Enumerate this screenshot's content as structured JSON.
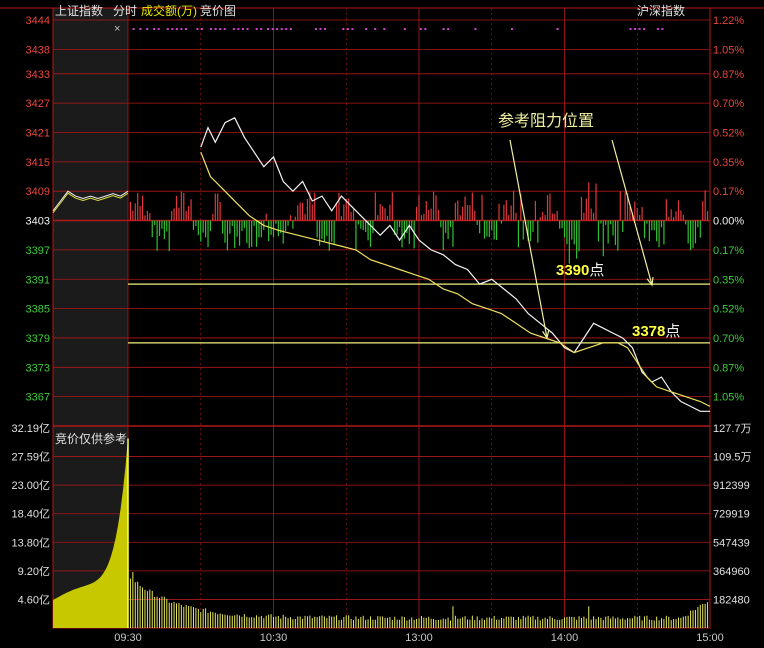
{
  "header": {
    "index_name": "上证指数",
    "tab_timeshare": "分时",
    "tab_turnover": "成交额(万)",
    "tab_auction": "竞价图",
    "right_label": "沪深指数",
    "close_symbol": "×"
  },
  "annotations": {
    "resistance_title": "参考阻力位置",
    "level1_value": "3390",
    "level2_value": "3378",
    "unit": "点"
  },
  "volume_panel_label": "竞价仅供参考",
  "chart_data": [
    {
      "type": "line",
      "title": "上证指数 分时",
      "prev_close": 3403,
      "y_ticks": [
        3444,
        3438,
        3433,
        3427,
        3421,
        3415,
        3409,
        3403,
        3397,
        3391,
        3385,
        3379,
        3373,
        3367
      ],
      "pct_ticks": [
        "1.22%",
        "1.05%",
        "0.87%",
        "0.70%",
        "0.52%",
        "0.35%",
        "0.17%",
        "0.00%",
        "0.17%",
        "0.35%",
        "0.52%",
        "0.70%",
        "0.87%",
        "1.05%"
      ],
      "ylim": [
        3361,
        3444
      ],
      "x_ticks": [
        "09:30",
        "10:30",
        "13:00",
        "14:00",
        "15:00"
      ],
      "horizontal_levels": [
        3390,
        3378
      ],
      "auction_series": [
        [
          0,
          3405
        ],
        [
          3,
          3407
        ],
        [
          6,
          3409
        ],
        [
          9,
          3408
        ],
        [
          12,
          3407.5
        ],
        [
          15,
          3408
        ],
        [
          18,
          3407.5
        ],
        [
          21,
          3408
        ],
        [
          24,
          3408.5
        ],
        [
          27,
          3408
        ],
        [
          30,
          3409
        ]
      ],
      "series": [
        {
          "points": [
            [
              30,
              3418
            ],
            [
              33,
              3422
            ],
            [
              36,
              3419
            ],
            [
              40,
              3423
            ],
            [
              44,
              3424
            ],
            [
              48,
              3420
            ],
            [
              52,
              3417
            ],
            [
              56,
              3414
            ],
            [
              60,
              3416
            ],
            [
              64,
              3411
            ],
            [
              68,
              3409
            ],
            [
              72,
              3411
            ],
            [
              76,
              3407
            ],
            [
              80,
              3408
            ],
            [
              84,
              3405
            ],
            [
              88,
              3408
            ],
            [
              92,
              3406
            ],
            [
              96,
              3404
            ],
            [
              100,
              3402
            ],
            [
              104,
              3400
            ],
            [
              108,
              3402
            ],
            [
              112,
              3399
            ],
            [
              116,
              3402
            ],
            [
              120,
              3399
            ],
            [
              125,
              3397
            ],
            [
              130,
              3396
            ],
            [
              135,
              3394
            ],
            [
              140,
              3393
            ],
            [
              145,
              3390
            ],
            [
              150,
              3391
            ],
            [
              155,
              3389
            ],
            [
              160,
              3387
            ],
            [
              165,
              3384
            ],
            [
              170,
              3382
            ],
            [
              175,
              3380
            ],
            [
              180,
              3377
            ],
            [
              184,
              3376
            ],
            [
              188,
              3379
            ],
            [
              192,
              3382
            ],
            [
              196,
              3381
            ],
            [
              200,
              3380
            ],
            [
              204,
              3379
            ],
            [
              208,
              3377
            ],
            [
              212,
              3372
            ],
            [
              216,
              3370
            ],
            [
              220,
              3371
            ],
            [
              224,
              3368
            ],
            [
              228,
              3366
            ],
            [
              232,
              3365
            ],
            [
              236,
              3364
            ],
            [
              240,
              3364
            ]
          ]
        },
        {
          "points": [
            [
              30,
              3417
            ],
            [
              34,
              3412
            ],
            [
              38,
              3410
            ],
            [
              42,
              3408
            ],
            [
              46,
              3406
            ],
            [
              50,
              3404
            ],
            [
              56,
              3402
            ],
            [
              62,
              3401
            ],
            [
              70,
              3400
            ],
            [
              78,
              3399
            ],
            [
              86,
              3398
            ],
            [
              94,
              3397
            ],
            [
              100,
              3395
            ],
            [
              106,
              3394
            ],
            [
              112,
              3393
            ],
            [
              118,
              3392
            ],
            [
              124,
              3391
            ],
            [
              130,
              3389
            ],
            [
              136,
              3388
            ],
            [
              142,
              3386
            ],
            [
              148,
              3385
            ],
            [
              154,
              3384
            ],
            [
              160,
              3382
            ],
            [
              166,
              3380
            ],
            [
              172,
              3379
            ],
            [
              178,
              3378
            ],
            [
              184,
              3376
            ],
            [
              190,
              3377
            ],
            [
              196,
              3378
            ],
            [
              202,
              3378
            ],
            [
              206,
              3377
            ],
            [
              210,
              3374
            ],
            [
              214,
              3371
            ],
            [
              218,
              3369
            ],
            [
              224,
              3368
            ],
            [
              230,
              3367
            ],
            [
              236,
              3366
            ],
            [
              240,
              3365
            ]
          ]
        }
      ]
    },
    {
      "type": "bar",
      "title": "成交额(万)",
      "ylim": [
        0,
        32.19
      ],
      "y_ticks_left": [
        "32.19亿",
        "27.59亿",
        "23.00亿",
        "18.40亿",
        "13.80亿",
        "9.20亿",
        "4.60亿"
      ],
      "y_ticks_right": [
        "127.7万",
        "109.5万",
        "912399",
        "729919",
        "547439",
        "364960",
        "182480"
      ],
      "peak_value": 30.5,
      "baseline_value": 1.2
    }
  ]
}
